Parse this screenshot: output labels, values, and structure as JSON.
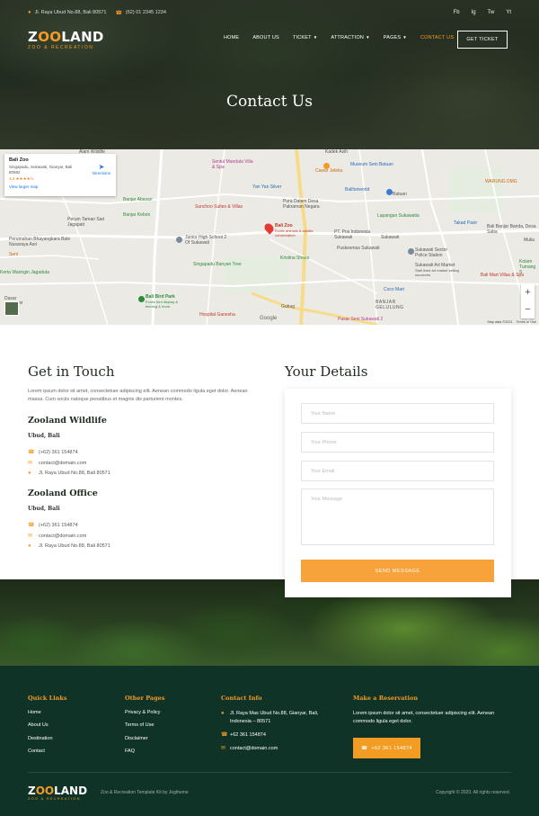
{
  "topbar": {
    "address": "Jl. Raya Ubud No.88, Bali 80571",
    "phone": "(62) 01 2345 1234",
    "social": [
      "Fb",
      "Ig",
      "Tw",
      "Yt"
    ]
  },
  "brand": {
    "name_start": "Z",
    "name_oo": "OO",
    "name_end": "LAND",
    "tagline": "ZOO & RECREATION"
  },
  "nav": {
    "items": [
      {
        "label": "HOME",
        "dropdown": false
      },
      {
        "label": "ABOUT US",
        "dropdown": false
      },
      {
        "label": "TICKET",
        "dropdown": true
      },
      {
        "label": "ATTRACTION",
        "dropdown": true
      },
      {
        "label": "PAGES",
        "dropdown": true
      },
      {
        "label": "CONTACT US",
        "dropdown": false,
        "active": true
      }
    ],
    "cta": "GET TICKET"
  },
  "hero": {
    "title": "Contact Us"
  },
  "map": {
    "card": {
      "title": "Bali Zoo",
      "address": "Singapadu, Sukawati, Gianyar, Bali 80582",
      "rating": "4.3 ★★★★½",
      "larger_map": "View larger map",
      "directions": "Directions"
    },
    "labels": {
      "alam_wildlife": "Alam Wildlife",
      "sentul_mandala": "Sentul Mandala Villa & Spa",
      "museum_seni": "Museum Seni Batuan",
      "cawar_jeleka": "Cawar Jeleka",
      "yan_yan": "Yan Yan Silver",
      "balifunworld": "Balifunworld",
      "warung_dmg": "WARUNG DMG",
      "banjar_abasan": "Banjar Abasan",
      "sunchoo": "Sunchoo Suites & Villas",
      "pura_dalem": "Pura Dalem Desa Pakraman Negara",
      "banjar_kebon": "Banjar Kebon",
      "lapangan": "Lapangan Sukawatia",
      "takad_pasir": "Takad Pasir",
      "perum_taman": "Perum Taman Sari Jagapati",
      "bali_zoo_pin": "Bali Zoo",
      "bali_zoo_sub": "Exotic animals & wildlife conservation",
      "junior_high": "Junior High School 2 Of Sukawati",
      "pt_pos": "PT. Pos Indonesia Sukawati",
      "bali_banjar": "Bali Banjar Banda, Desa Saba",
      "perumahan": "Perumahan Bhayangkara Bale Nusaraya Asri",
      "puskesmas": "Puskesmas Sukawati",
      "sukawati_sector": "Sukawati Sector Police Station",
      "senj": "Seni",
      "singapadu": "Singapadu Banyan Tree",
      "kristina": "Kristina Shoes",
      "sukawati_art": "Sukawati Art Market",
      "sukawati_art_sub": "Stall lined art market selling souvenirs",
      "kerta": "Kerta Waringin Jagaduta",
      "bali_mart": "Bali Mart Villas & Spa",
      "kolam": "Kolam Tumang S",
      "coco_mart": "Coco Mart",
      "banjar_gelulung": "BANJAR GELULUNG",
      "dasar": "Dasar",
      "bali_bird": "Bali Bird Park",
      "bali_bird_sub": "Exotic bird display & feeding & more",
      "hospital": "Hospital Ganesha",
      "pasar_seni": "Pasar Seni Sukawati 2",
      "gubug": "Gubug",
      "batuan": "Batuan",
      "kadek": "Kadek Asih",
      "mulia": "Mulia",
      "rsi": "rsi",
      "sukawati": "Sukawati"
    },
    "google": "Google",
    "map_data": "Map data ©2021",
    "terms": "Terms of Use",
    "zoom_in": "+",
    "zoom_out": "−"
  },
  "contact": {
    "heading": "Get in Touch",
    "lorem": "Lorem ipsum dolor sit amet, consectetuer adipiscing elit. Aenean commodo ligula eget dolor. Aenean massa. Cum sociis natoque penatibus et magnis dis parturient montes.",
    "offices": [
      {
        "name": "Zooland Wildlife",
        "city": "Ubud, Bali",
        "phone": "(+62) 361 154874",
        "email": "contact@domain.com",
        "address": "Jl. Raya Ubud No.88, Bali 80571"
      },
      {
        "name": "Zooland Office",
        "city": "Ubud, Bali",
        "phone": "(+62) 361 154874",
        "email": "contact@domain.com",
        "address": "Jl. Raya Ubud No.88, Bali 80571"
      }
    ]
  },
  "form": {
    "heading": "Your Details",
    "name_ph": "Your Name",
    "phone_ph": "Your Phone",
    "email_ph": "Your Email",
    "message_ph": "Your Message",
    "submit": "SEND MESSAGE"
  },
  "footer": {
    "quick_links": {
      "title": "Quick Links",
      "items": [
        "Home",
        "About Us",
        "Destination",
        "Contact"
      ]
    },
    "other_pages": {
      "title": "Other Pages",
      "items": [
        "Privacy & Policy",
        "Terms of Use",
        "Disclaimer",
        "FAQ"
      ]
    },
    "contact_info": {
      "title": "Contact Info",
      "address": "Jl. Raya Mas Ubud No.88, Gianyar, Bali, Indonesia – 80571",
      "phone": "+62 361 154874",
      "email": "contact@domain.com"
    },
    "reservation": {
      "title": "Make a Reservation",
      "text": "Lorem ipsum dolor sit amet, consectetuer adipiscing elit. Aenean commodo ligula eget dolor.",
      "button": "+62 361 154874"
    },
    "credit": "Zoo & Recreation Template Kit by Jegtheme",
    "copyright": "Copyright © 2020. All rights reserved."
  },
  "colors": {
    "accent": "#f39c24",
    "footer_bg": "#0f3326",
    "heading": "#1e2a1e"
  }
}
